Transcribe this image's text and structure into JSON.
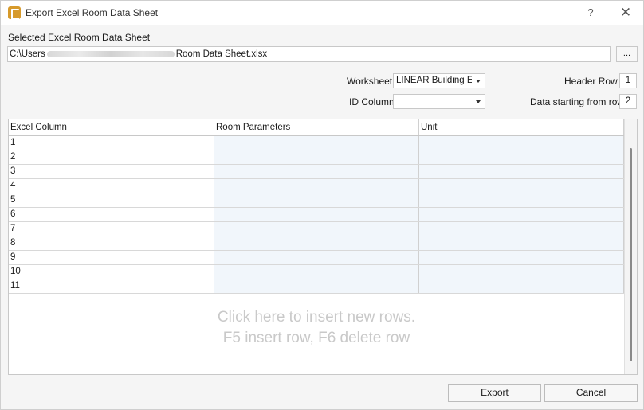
{
  "window": {
    "title": "Export Excel Room Data Sheet",
    "help_label": "?",
    "close_label": "✕"
  },
  "file": {
    "label": "Selected Excel Room Data Sheet",
    "path_prefix": "C:\\Users",
    "path_suffix": "Room Data Sheet.xlsx",
    "browse_label": "..."
  },
  "worksheet": {
    "label": "Worksheet",
    "value": "LINEAR Building E:"
  },
  "id_column": {
    "label": "ID Column",
    "value": ""
  },
  "header_row": {
    "label": "Header Row",
    "value": "1"
  },
  "data_start": {
    "label": "Data starting from row",
    "value": "2"
  },
  "grid": {
    "columns": [
      "Excel Column",
      "Room Parameters",
      "Unit"
    ],
    "rows": [
      {
        "excel_column": "1",
        "room_parameter": "",
        "unit": ""
      },
      {
        "excel_column": "2",
        "room_parameter": "",
        "unit": ""
      },
      {
        "excel_column": "3",
        "room_parameter": "",
        "unit": ""
      },
      {
        "excel_column": "4",
        "room_parameter": "",
        "unit": ""
      },
      {
        "excel_column": "5",
        "room_parameter": "",
        "unit": ""
      },
      {
        "excel_column": "6",
        "room_parameter": "",
        "unit": ""
      },
      {
        "excel_column": "7",
        "room_parameter": "",
        "unit": ""
      },
      {
        "excel_column": "8",
        "room_parameter": "",
        "unit": ""
      },
      {
        "excel_column": "9",
        "room_parameter": "",
        "unit": ""
      },
      {
        "excel_column": "10",
        "room_parameter": "",
        "unit": ""
      },
      {
        "excel_column": "11",
        "room_parameter": "",
        "unit": ""
      }
    ],
    "insert_hint_line1": "Click here to insert new rows.",
    "insert_hint_line2": "F5 insert row, F6 delete row"
  },
  "buttons": {
    "export": "Export",
    "cancel": "Cancel"
  },
  "colors": {
    "app_icon": "#d79a2b",
    "editable_cell_bg": "#f1f6fb",
    "hint_text": "#c9c9c9"
  }
}
